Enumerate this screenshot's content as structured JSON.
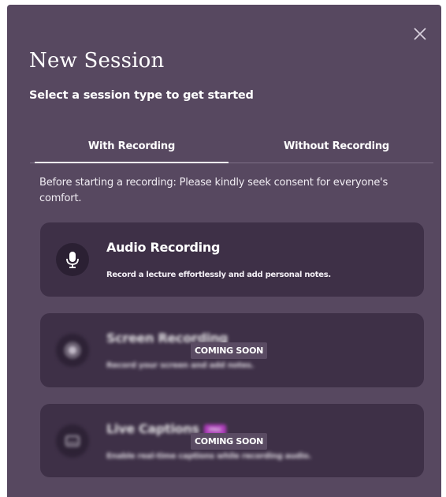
{
  "modal": {
    "title": "New Session",
    "subtitle": "Select a session type to get started",
    "close_icon": "close-icon"
  },
  "tabs": [
    {
      "label": "With Recording",
      "active": true
    },
    {
      "label": "Without Recording",
      "active": false
    }
  ],
  "notice": "Before starting a recording: Please kindly seek consent for everyone's comfort.",
  "cards": [
    {
      "title": "Audio Recording",
      "description": "Record a lecture effortlessly and add personal notes.",
      "icon": "microphone-icon",
      "available": true
    },
    {
      "title": "Screen Recording",
      "description": "Record your screen and add notes.",
      "icon": "screen-record-icon",
      "available": false,
      "badge": "COMING SOON"
    },
    {
      "title": "Live Captions",
      "description": "Enable real-time captions while recording audio.",
      "icon": "captions-icon",
      "available": false,
      "pill": "PRO",
      "badge": "COMING SOON"
    }
  ],
  "colors": {
    "modal_bg": "#574860",
    "card_bg": "#3e3047",
    "icon_bg": "#2b2033",
    "pill_bg": "#c23fd0",
    "badge_bg": "#5a4b63"
  }
}
